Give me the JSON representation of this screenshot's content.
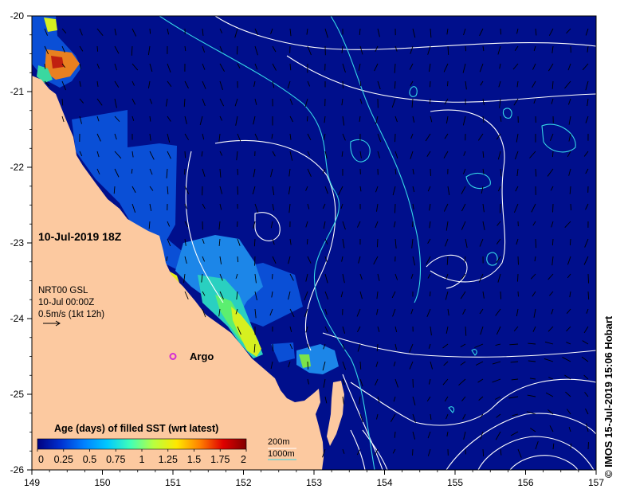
{
  "map": {
    "region": "Queensland coast",
    "lon_range": [
      149,
      157
    ],
    "lat_range": [
      -26,
      -20
    ],
    "x_ticks": [
      "149",
      "150",
      "151",
      "152",
      "153",
      "154",
      "155",
      "156",
      "157"
    ],
    "y_ticks": [
      "-20",
      "-21",
      "-22",
      "-23",
      "-24",
      "-25",
      "-26"
    ],
    "colors": {
      "ocean": "#000f8c",
      "land": "#fcc9a0",
      "sst_contour": "#ffffff",
      "isobath_1000m": "#36d7e6",
      "argo_marker": "#d42bd4"
    }
  },
  "date_label": "10-Jul-2019 18Z",
  "current_info": {
    "product": "NRT00 GSL",
    "time": "10-Jul 00:00Z",
    "scale": "0.5m/s (1kt 12h)"
  },
  "argo": {
    "label": "Argo",
    "lon": 151.0,
    "lat": -24.5
  },
  "colorbar": {
    "title": "Age (days) of filled SST (wrt latest)",
    "ticks": [
      "0",
      "0.25",
      "0.5",
      "0.75",
      "1",
      "1.25",
      "1.5",
      "1.75",
      "2"
    ],
    "stops": [
      "#000080",
      "#0030d0",
      "#0080ff",
      "#00c8ff",
      "#40ffb8",
      "#b8ff40",
      "#ffe800",
      "#ff8000",
      "#e00000",
      "#800000"
    ]
  },
  "isobath_legend": {
    "line1": "200m",
    "line2": "1000m"
  },
  "credit": "© IMOS 15-Jul-2019 15:06 Hobart"
}
